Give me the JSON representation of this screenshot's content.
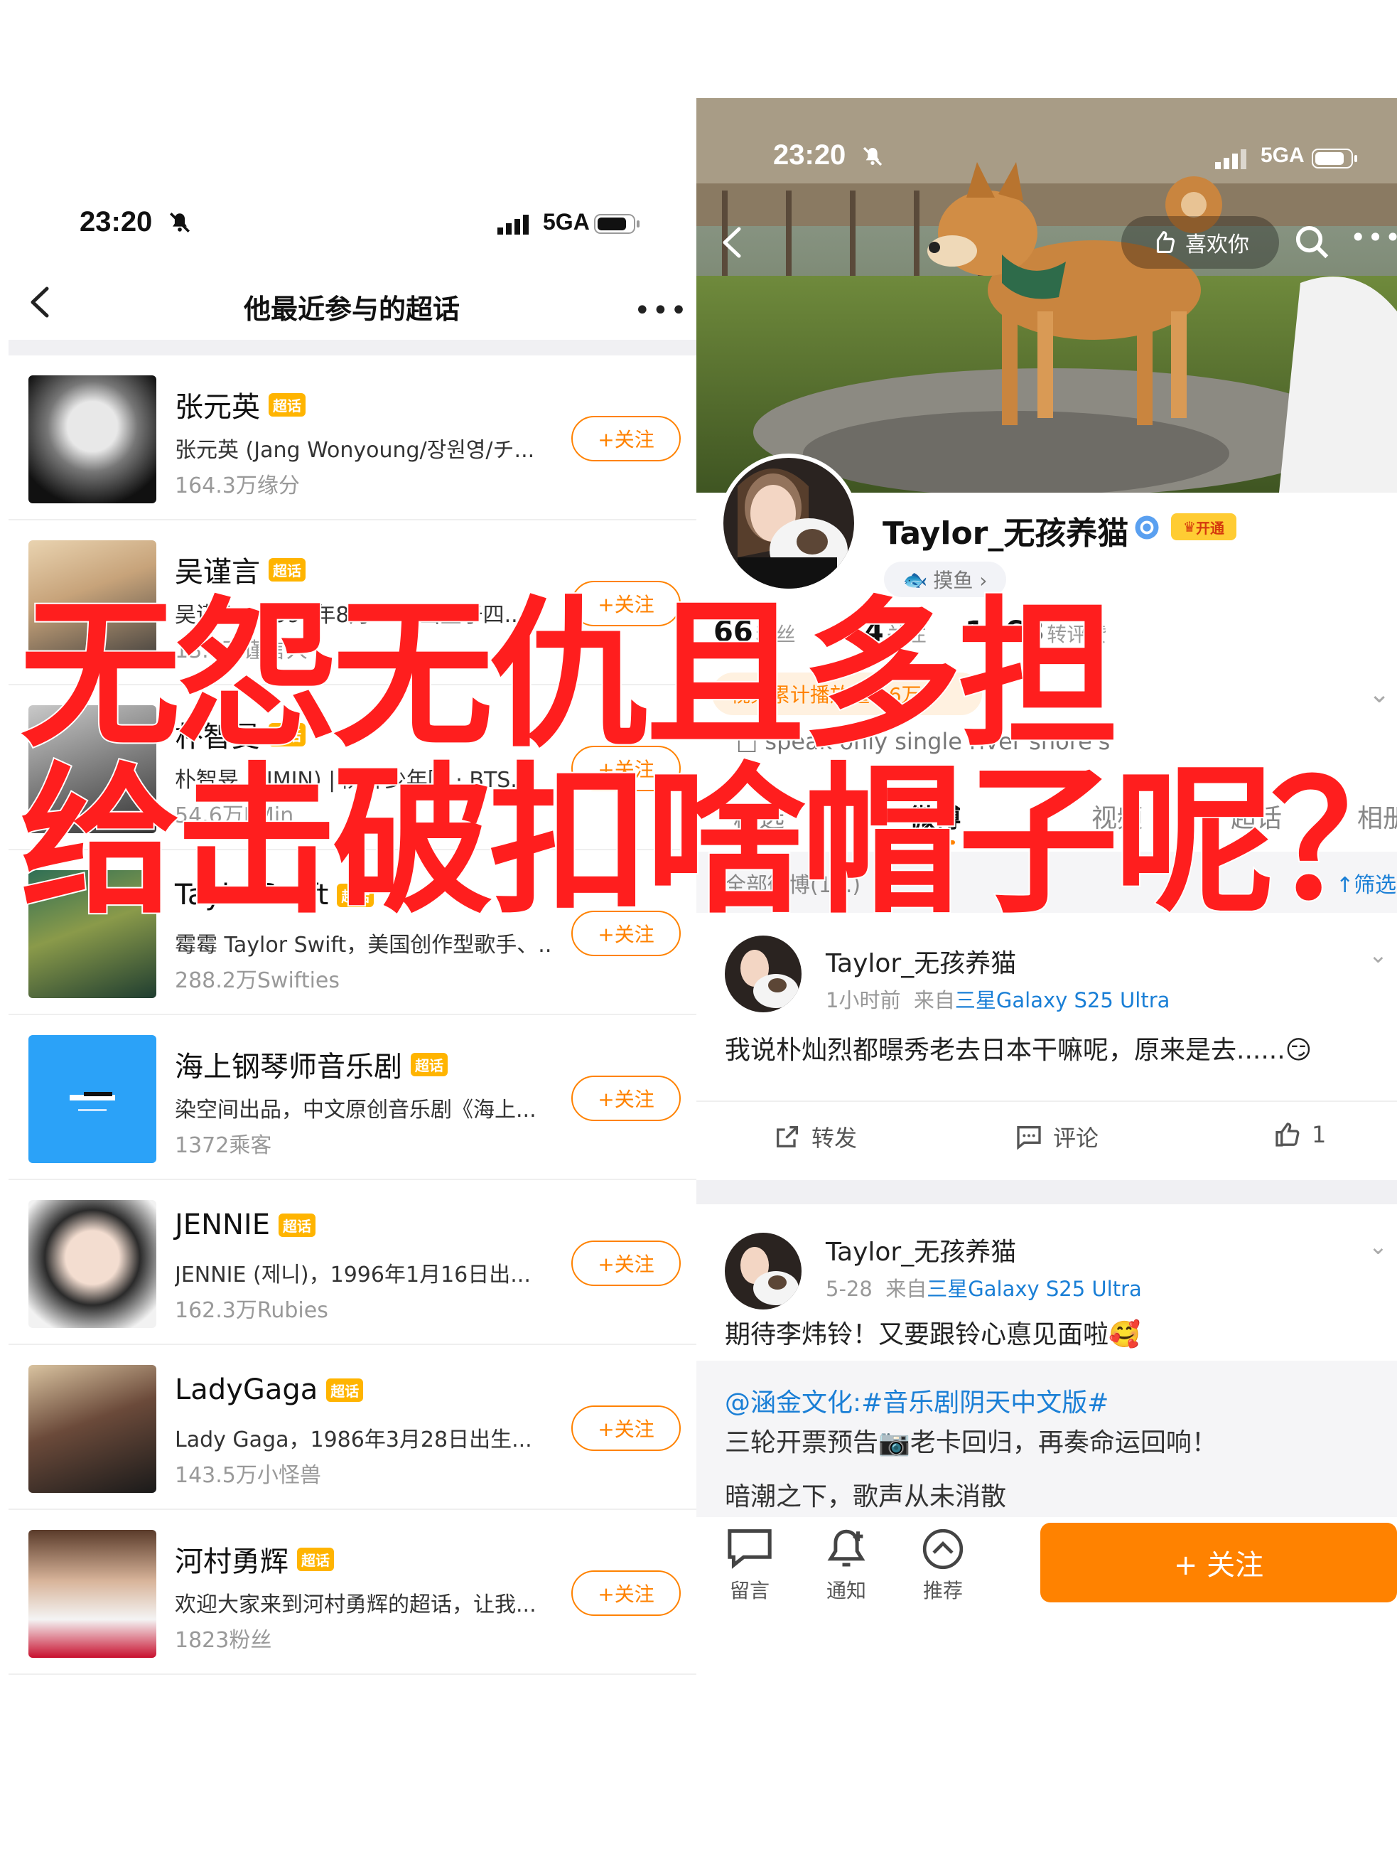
{
  "left_screen": {
    "status": {
      "time": "23:20",
      "network": "5GA"
    },
    "title": "他最近参与的超话",
    "follow_label": "+关注",
    "tag_label": "超话",
    "rows": [
      {
        "name": "张元英",
        "desc": "张元英 (Jang Wonyoung/장원영/チ...",
        "fans": "164.3万缘分"
      },
      {
        "name": "吴谨言",
        "desc": "吴谨言，1990年8月16日出生于四...",
        "fans": "13.6万谨言人"
      },
      {
        "name": "朴智旻",
        "desc": "朴智旻（JIMIN) | 防弹少年团 · BTS...",
        "fans": "54.6万JiMin"
      },
      {
        "name": "TaylorSwift",
        "desc": "霉霉 Taylor Swift，美国创作型歌手、..",
        "fans": "288.2万Swifties"
      },
      {
        "name": "海上钢琴师音乐剧",
        "desc": "染空间出品，中文原创音乐剧《海上...",
        "fans": "1372乘客"
      },
      {
        "name": "JENNIE",
        "desc": "JENNIE (제니)，1996年1月16日出...",
        "fans": "162.3万Rubies"
      },
      {
        "name": "LadyGaga",
        "desc": "Lady Gaga，1986年3月28日出生...",
        "fans": "143.5万小怪兽"
      },
      {
        "name": "河村勇辉",
        "desc": "欢迎大家来到河村勇辉的超话，让我...",
        "fans": "1823粉丝"
      }
    ]
  },
  "right_screen": {
    "status": {
      "time": "23:20",
      "network": "5GA"
    },
    "like_label": "喜欢你",
    "username": "Taylor_无孩养猫",
    "vip_label": "开通",
    "fish_label": "摸鱼 ›",
    "stats": [
      {
        "num": "66",
        "label": "粉丝"
      },
      {
        "num": "84",
        "label": "关注"
      },
      {
        "num": "1268",
        "label": "转评赞"
      }
    ],
    "video_banner": "视频累计播放量1.6万",
    "bio": "□ speak only single river shore's",
    "tabs": [
      "精选",
      "微博",
      "视频",
      "超话",
      "相册"
    ],
    "all_weibo": "全部微博(1...)",
    "filter_label": "筛选",
    "posts": [
      {
        "name": "Taylor_无孩养猫",
        "time": "1小时前",
        "from": "来自",
        "device": "三星Galaxy S25 Ultra",
        "text": "我说朴灿烈都暻秀老去日本干嘛呢，原来是去......😏"
      },
      {
        "name": "Taylor_无孩养猫",
        "time": "5-28",
        "from": "来自",
        "device": "三星Galaxy S25 Ultra",
        "text": "期待李炜铃！又要跟铃心悳见面啦🥰"
      }
    ],
    "actions": {
      "repost": "转发",
      "comment": "评论",
      "like": "1"
    },
    "repost": {
      "line1": "@涵金文化:#音乐剧阴天中文版#",
      "line2": "三轮开票预告📷老卡回归，再奏命运回响！",
      "line3": "暗潮之下，歌声从未消散"
    },
    "bottom": {
      "message": "留言",
      "notify": "通知",
      "recommend": "推荐",
      "follow": "+ 关注"
    }
  },
  "overlay": {
    "line1": "无怨无仇且多担",
    "line2": "给击破扣啥帽子呢？"
  },
  "colors": {
    "accent": "#ff8200",
    "link": "#1a7fd6",
    "overlay_text": "#ff1e1e",
    "tag": "#ffb400"
  }
}
